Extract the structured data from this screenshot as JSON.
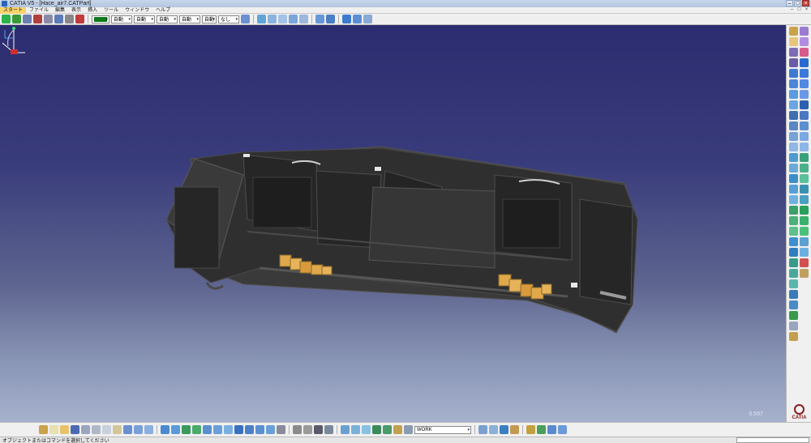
{
  "window": {
    "title": "CATIA V5 - [Hace_air7.CATPart]"
  },
  "window_buttons": {
    "minimize": "–",
    "maximize": "□",
    "close": "×"
  },
  "menu": {
    "items": [
      "スタート",
      "ファイル",
      "編集",
      "表示",
      "挿入",
      "ツール",
      "ウィンドウ",
      "ヘルプ"
    ],
    "active_index": 0
  },
  "toolbar": {
    "color_value": "#0b7a1a",
    "combos": [
      {
        "value": "自動"
      },
      {
        "value": "自動"
      },
      {
        "value": "自動"
      },
      {
        "value": "自動"
      },
      {
        "value": "自動"
      },
      {
        "value": "なし"
      }
    ]
  },
  "bottom_toolbar": {
    "layer_value": "WORK"
  },
  "viewport": {
    "scale_label": "0.567"
  },
  "status": {
    "message": "オブジェクトまたはコマンドを選択してください"
  },
  "brand": {
    "logo_text": "CATIA"
  },
  "colors": {
    "viewport_top": "#2c2c70",
    "viewport_bottom": "#a6b1cd",
    "part_body": "#2e2e2e",
    "part_highlight": "#e0a84a",
    "menu_active": "#f7d36a"
  }
}
